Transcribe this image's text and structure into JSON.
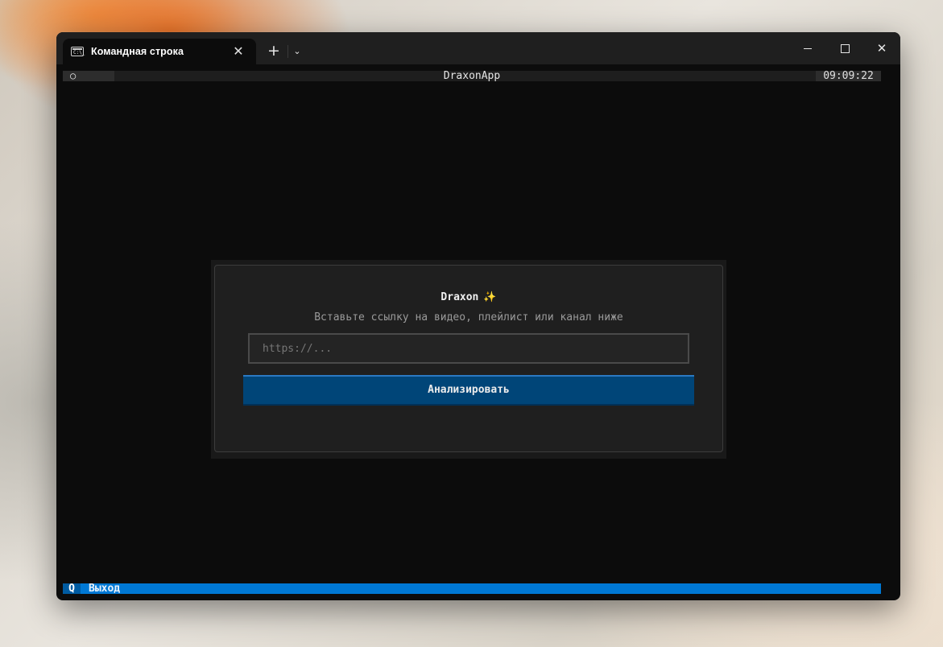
{
  "window": {
    "tab_title": "Командная строка",
    "tab_icon": "cmd-icon",
    "tab_icon_text": "C:\\_",
    "new_tab": "+",
    "dropdown": "⌄",
    "close_tab": "✕",
    "controls": [
      "minimize",
      "maximize",
      "close"
    ],
    "close_glyph": "✕"
  },
  "header": {
    "icon": "○",
    "title": "DraxonApp",
    "clock": "09:09:22"
  },
  "dialog": {
    "title": "Draxon",
    "title_emoji": "✨",
    "subtitle": "Вставьте ссылку на видео, плейлист или канал ниже",
    "input_placeholder": "https://...",
    "input_value": "",
    "button_label": "Анализировать"
  },
  "footer": {
    "key": "Q",
    "label": "Выход"
  },
  "colors": {
    "terminal_bg": "#0c0c0c",
    "button_bg": "#004578",
    "footer_bg": "#0078d4",
    "sparkle": "#f5c542"
  }
}
